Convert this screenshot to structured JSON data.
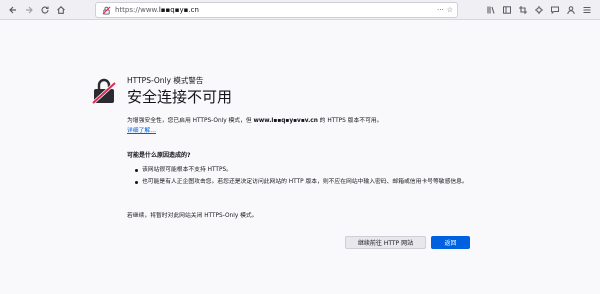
{
  "browser": {
    "url_prefix": "https://www.",
    "url_host": "l▪▪q▪y▪.cn",
    "colors": {
      "toolbar": "#f0f0f4",
      "accent": "#0061e0"
    }
  },
  "page": {
    "icon": "broken-lock-icon",
    "small_title": "HTTPS-Only 模式警告",
    "big_title": "安全连接不可用",
    "desc_before": "为增强安全性，您已启用 HTTPS-Only 模式，但 ",
    "desc_host": "www.l▪▪q▪y▪v▪v.cn",
    "desc_after": " 的 HTTPS 版本不可用。",
    "learn_more": "详细了解…",
    "reasons_title": "可能是什么原因造成的?",
    "reasons": [
      "该网站很可能根本不支持 HTTPS。",
      "也可能是有人正企图攻击您。若您还是决定访问此网站的 HTTP 版本，则不应在网站中输入密码、邮箱或信用卡号等敏感信息。"
    ],
    "continue_note": "若继续，将暂时对此网站关闭 HTTPS-Only 模式。",
    "btn_continue": "继续前往 HTTP 网站",
    "btn_back": "返回"
  }
}
